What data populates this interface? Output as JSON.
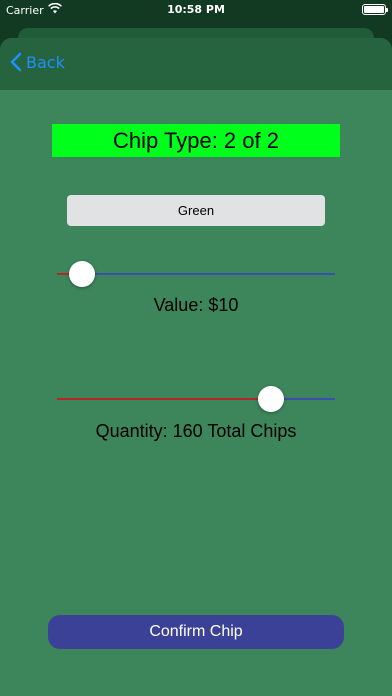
{
  "status_bar": {
    "carrier": "Carrier",
    "time": "10:58 PM",
    "battery_level": 1.0
  },
  "nav": {
    "back_label": "Back"
  },
  "chip": {
    "title": "Chip Type: 2 of 2",
    "color_name": "Green",
    "value_slider_fraction": 0.09,
    "value_label": "Value: $10",
    "quantity_slider_fraction": 0.77,
    "quantity_label": "Quantity: 160 Total Chips"
  },
  "actions": {
    "confirm_label": "Confirm Chip"
  },
  "colors": {
    "title_background": "#00ff1a",
    "slider_min_track": "#b5262a",
    "slider_max_track": "#3b4fae",
    "confirm_button": "#3b4196",
    "back_tint": "#1e90ff"
  },
  "icons": {
    "back": "chevron-left-icon",
    "wifi": "wifi-icon",
    "battery": "battery-icon"
  }
}
